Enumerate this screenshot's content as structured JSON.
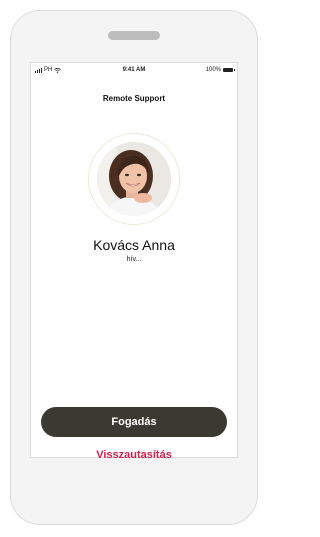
{
  "status_bar": {
    "carrier": "PH",
    "time": "9:41 AM",
    "battery": "100%"
  },
  "screen": {
    "title": "Remote Support"
  },
  "call": {
    "caller_name": "Kovács Anna",
    "status": "hív...",
    "accept_label": "Fogadás",
    "decline_label": "Visszautasítás"
  },
  "colors": {
    "accept_button": "#3a3a32",
    "decline_text": "#d61f4a",
    "phone_frame": "#f4f4f4"
  }
}
